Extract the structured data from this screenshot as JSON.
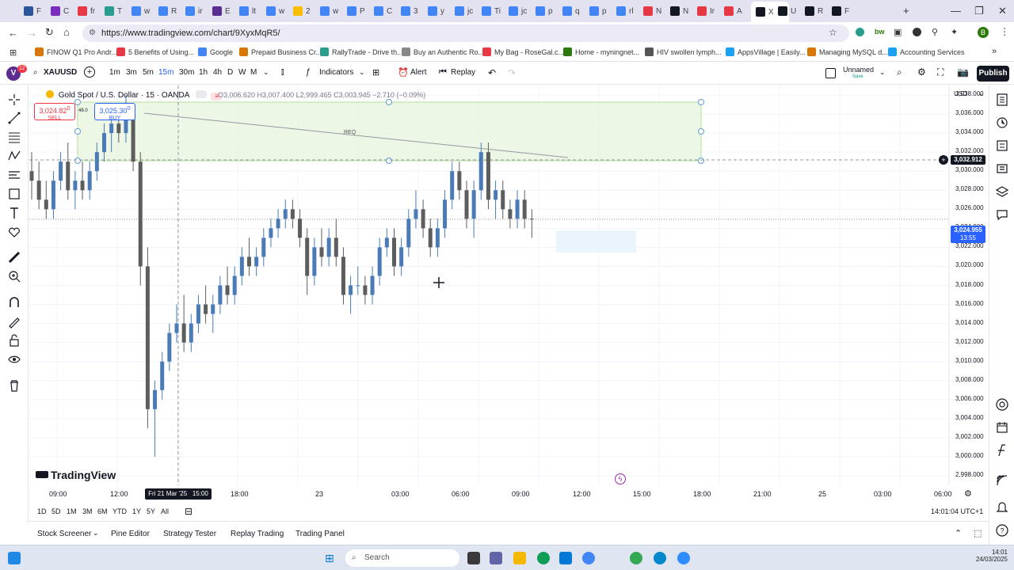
{
  "browser": {
    "tabs": [
      {
        "label": "F",
        "color": "#2b579a"
      },
      {
        "label": "C",
        "color": "#7b2cbf"
      },
      {
        "label": "fr",
        "color": "#e63946"
      },
      {
        "label": "T",
        "color": "#2a9d8f"
      },
      {
        "label": "w",
        "color": "#4285f4"
      },
      {
        "label": "R",
        "color": "#4285f4"
      },
      {
        "label": "ir",
        "color": "#4285f4"
      },
      {
        "label": "E",
        "color": "#5c2d91"
      },
      {
        "label": "lt",
        "color": "#4285f4"
      },
      {
        "label": "w",
        "color": "#4285f4"
      },
      {
        "label": "2",
        "color": "#fbbc04"
      },
      {
        "label": "w",
        "color": "#4285f4"
      },
      {
        "label": "P",
        "color": "#4285f4"
      },
      {
        "label": "C",
        "color": "#4285f4"
      },
      {
        "label": "3",
        "color": "#4285f4"
      },
      {
        "label": "y",
        "color": "#4285f4"
      },
      {
        "label": "jc",
        "color": "#4285f4"
      },
      {
        "label": "Ti",
        "color": "#4285f4"
      },
      {
        "label": "jc",
        "color": "#4285f4"
      },
      {
        "label": "p",
        "color": "#4285f4"
      },
      {
        "label": "q",
        "color": "#4285f4"
      },
      {
        "label": "p",
        "color": "#4285f4"
      },
      {
        "label": "rl",
        "color": "#4285f4"
      },
      {
        "label": "N",
        "color": "#e63946"
      },
      {
        "label": "N",
        "color": "#131722"
      },
      {
        "label": "Ir",
        "color": "#e63946"
      },
      {
        "label": "A",
        "color": "#e63946"
      },
      {
        "label": "X",
        "color": "#131722"
      },
      {
        "label": "U",
        "color": "#131722"
      },
      {
        "label": "R",
        "color": "#131722"
      },
      {
        "label": "F",
        "color": "#131722"
      }
    ],
    "url": "https://www.tradingview.com/chart/9XyxMqR5/",
    "bookmarks": [
      {
        "label": "FINOW Q1 Pro Andr...",
        "color": "#d97706"
      },
      {
        "label": "5 Benefits of Using...",
        "color": "#e63946"
      },
      {
        "label": "Google",
        "color": "#4285f4"
      },
      {
        "label": "Prepaid Business Cr...",
        "color": "#d97706"
      },
      {
        "label": "RallyTrade - Drive th...",
        "color": "#2a9d8f"
      },
      {
        "label": "Buy an Authentic Ro...",
        "color": "#888888"
      },
      {
        "label": "My Bag - RoseGal.c...",
        "color": "#e63946"
      },
      {
        "label": "Home - myningnet...",
        "color": "#2b7a0b"
      },
      {
        "label": "HIV swollen lymph...",
        "color": "#555555"
      },
      {
        "label": "AppsVillage | Easily...",
        "color": "#1da1f2"
      },
      {
        "label": "Managing MySQL d...",
        "color": "#d97706"
      },
      {
        "label": "Accounting Services",
        "color": "#1da1f2"
      }
    ]
  },
  "toolbar": {
    "avatar_letter": "V",
    "avatar_badge": "12",
    "symbol": "XAUUSD",
    "intervals": [
      "1m",
      "3m",
      "5m",
      "15m",
      "30m",
      "1h",
      "4h",
      "D",
      "W",
      "M"
    ],
    "active_interval": "15m",
    "indicators_label": "Indicators",
    "alert_label": "Alert",
    "replay_label": "Replay",
    "layout_name": "Unnamed",
    "layout_sub": "Save",
    "publish_label": "Publish"
  },
  "legend": {
    "title": "Gold Spot / U.S. Dollar · 15 · OANDA",
    "ohlc": "O3,006.620  H3,007.400  L2,999.465  C3,003.945  −2.710 (−0.09%)",
    "sell_price": "3,024.82",
    "sell_sup": "0",
    "sell_label": "SELL",
    "buy_price": "3,025.30",
    "buy_sup": "0",
    "buy_label": "BUY",
    "spread": "48.0",
    "req_label": "REQ",
    "watermark": "TradingView"
  },
  "price_axis": {
    "currency": "USD",
    "ticks": [
      "3,038.000",
      "3,036.000",
      "3,034.000",
      "3,032.000",
      "3,030.000",
      "3,028.000",
      "3,026.000",
      "3,024.000",
      "3,022.000",
      "3,020.000",
      "3,018.000",
      "3,016.000",
      "3,014.000",
      "3,012.000",
      "3,010.000",
      "3,008.000",
      "3,006.000",
      "3,004.000",
      "3,002.000",
      "3,000.000",
      "2,998.000"
    ],
    "crosshair_price": "3,032.912",
    "last_price": "3,024.955",
    "countdown": "13:55",
    "last_price_color": "#2962ff"
  },
  "time_axis": {
    "ticks": [
      "09:00",
      "12:00",
      "18:00",
      "23",
      "03:00",
      "06:00",
      "09:00",
      "12:00",
      "15:00",
      "18:00",
      "21:00",
      "25",
      "03:00",
      "06:00"
    ],
    "crosshair_time": "Fri 21 Mar '25   15:00"
  },
  "range_bar": {
    "ranges": [
      "1D",
      "5D",
      "1M",
      "3M",
      "6M",
      "YTD",
      "1Y",
      "5Y",
      "All"
    ],
    "clock": "14:01:04 UTC+1"
  },
  "bottom_tabs": [
    "Stock Screener",
    "Pine Editor",
    "Strategy Tester",
    "Replay Trading",
    "Trading Panel"
  ],
  "taskbar": {
    "search_placeholder": "Search",
    "time": "14:01",
    "date": "24/03/2025"
  },
  "colors": {
    "up": "#4a7bb7",
    "down": "#5d5d5d",
    "accent": "#2962ff",
    "zone_fill": "#e6f4dc",
    "zone_border": "#b7dca0"
  },
  "chart_data": {
    "type": "candlestick",
    "symbol": "XAUUSD",
    "interval": "15",
    "ylim": [
      2997,
      3039
    ],
    "candles": [
      [
        3030,
        3032,
        3027,
        3029
      ],
      [
        3029,
        3031,
        3026,
        3027
      ],
      [
        3027,
        3029,
        3025,
        3026
      ],
      [
        3026,
        3030,
        3025,
        3029
      ],
      [
        3029,
        3032,
        3028,
        3031
      ],
      [
        3031,
        3033,
        3027,
        3028
      ],
      [
        3028,
        3030,
        3026,
        3029
      ],
      [
        3029,
        3031,
        3027,
        3028
      ],
      [
        3028,
        3031,
        3027,
        3030
      ],
      [
        3030,
        3033,
        3029,
        3032
      ],
      [
        3032,
        3035,
        3031,
        3034
      ],
      [
        3034,
        3036,
        3032,
        3035
      ],
      [
        3035,
        3037,
        3033,
        3034
      ],
      [
        3034,
        3038,
        3033,
        3036
      ],
      [
        3036,
        3037,
        3030,
        3031
      ],
      [
        3031,
        3032,
        3018,
        3020
      ],
      [
        3020,
        3022,
        3003,
        3005
      ],
      [
        3005,
        3008,
        3000,
        3007
      ],
      [
        3007,
        3011,
        3006,
        3010
      ],
      [
        3010,
        3014,
        3009,
        3013
      ],
      [
        3013,
        3016,
        3012,
        3014
      ],
      [
        3014,
        3017,
        3011,
        3012
      ],
      [
        3012,
        3015,
        3011,
        3014
      ],
      [
        3014,
        3017,
        3013,
        3016
      ],
      [
        3016,
        3018,
        3014,
        3015
      ],
      [
        3015,
        3017,
        3013,
        3016
      ],
      [
        3016,
        3019,
        3015,
        3018
      ],
      [
        3018,
        3020,
        3016,
        3017
      ],
      [
        3017,
        3020,
        3016,
        3019
      ],
      [
        3019,
        3022,
        3018,
        3021
      ],
      [
        3021,
        3023,
        3019,
        3020
      ],
      [
        3020,
        3022,
        3019,
        3021
      ],
      [
        3021,
        3024,
        3020,
        3023
      ],
      [
        3023,
        3025,
        3022,
        3024
      ],
      [
        3024,
        3026,
        3023,
        3025
      ],
      [
        3025,
        3027,
        3024,
        3026
      ],
      [
        3026,
        3027,
        3024,
        3025
      ],
      [
        3025,
        3026,
        3022,
        3023
      ],
      [
        3023,
        3024,
        3017,
        3019
      ],
      [
        3019,
        3023,
        3018,
        3022
      ],
      [
        3022,
        3024,
        3020,
        3021
      ],
      [
        3021,
        3024,
        3020,
        3023
      ],
      [
        3023,
        3025,
        3020,
        3021
      ],
      [
        3021,
        3022,
        3016,
        3017
      ],
      [
        3017,
        3019,
        3015,
        3018
      ],
      [
        3018,
        3020,
        3017,
        3018
      ],
      [
        3018,
        3019,
        3016,
        3017
      ],
      [
        3017,
        3020,
        3016,
        3019
      ],
      [
        3019,
        3023,
        3018,
        3022
      ],
      [
        3022,
        3024,
        3021,
        3023
      ],
      [
        3023,
        3024,
        3019,
        3020
      ],
      [
        3020,
        3023,
        3019,
        3022
      ],
      [
        3022,
        3026,
        3021,
        3025
      ],
      [
        3025,
        3028,
        3024,
        3026
      ],
      [
        3026,
        3027,
        3023,
        3024
      ],
      [
        3024,
        3025,
        3021,
        3022
      ],
      [
        3022,
        3025,
        3021,
        3024
      ],
      [
        3024,
        3028,
        3023,
        3027
      ],
      [
        3027,
        3031,
        3026,
        3030
      ],
      [
        3030,
        3031,
        3027,
        3028
      ],
      [
        3028,
        3029,
        3024,
        3025
      ],
      [
        3025,
        3029,
        3023,
        3028
      ],
      [
        3028,
        3033,
        3027,
        3032
      ],
      [
        3032,
        3033,
        3026,
        3027
      ],
      [
        3027,
        3029,
        3025,
        3028
      ],
      [
        3028,
        3029,
        3025,
        3026
      ],
      [
        3026,
        3027,
        3024,
        3025
      ],
      [
        3025,
        3028,
        3024,
        3027
      ],
      [
        3027,
        3028,
        3024,
        3025
      ],
      [
        3025,
        3026,
        3023,
        3024.955
      ]
    ]
  }
}
